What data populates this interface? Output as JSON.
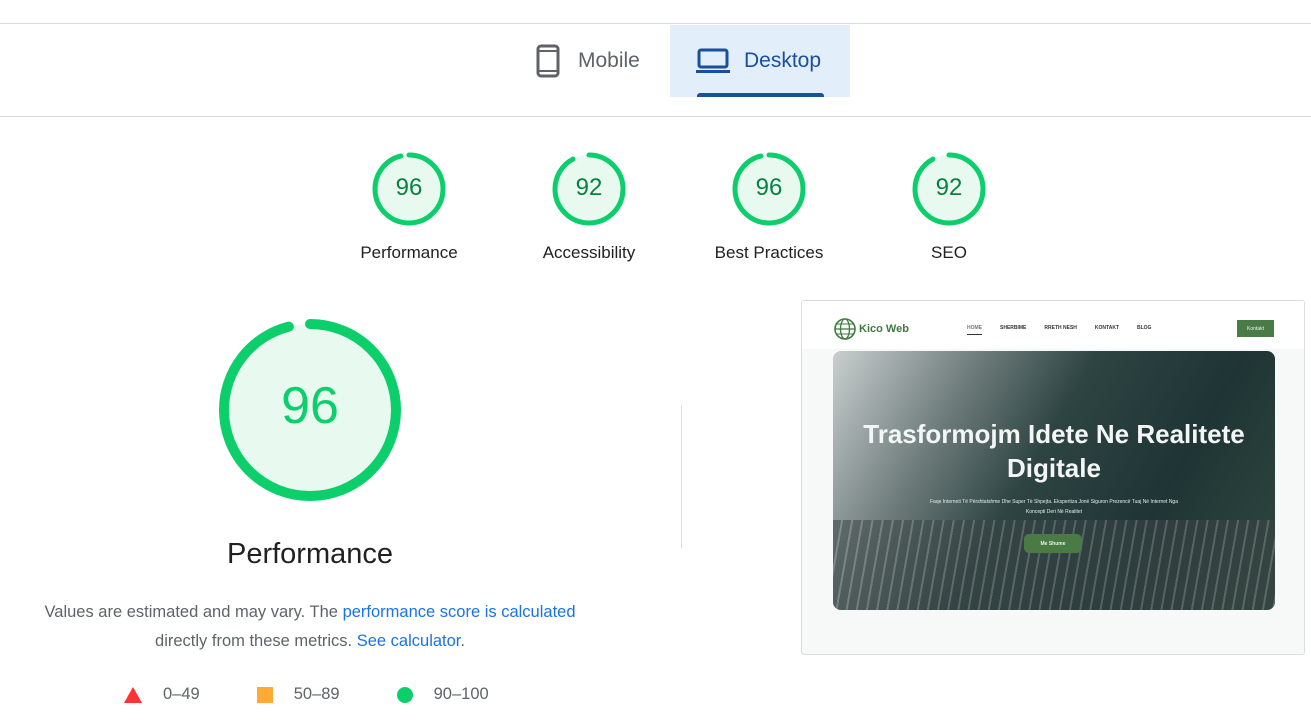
{
  "tabs": [
    {
      "label": "Mobile",
      "icon": "mobile-phone-icon",
      "selected": false
    },
    {
      "label": "Desktop",
      "icon": "laptop-icon",
      "selected": true
    }
  ],
  "categories": [
    {
      "label": "Performance",
      "score": 96
    },
    {
      "label": "Accessibility",
      "score": 92
    },
    {
      "label": "Best Practices",
      "score": 96
    },
    {
      "label": "SEO",
      "score": 92
    }
  ],
  "main": {
    "score": 96,
    "title": "Performance",
    "desc_prefix": "Values are estimated and may vary. The ",
    "desc_link": "performance score is calculated",
    "desc_mid": " directly from these metrics. ",
    "desc_link2": "See calculator",
    "desc_suffix": "."
  },
  "legend": [
    {
      "label": "0–49",
      "color": "#ff3333",
      "shape": "triangle"
    },
    {
      "label": "50–89",
      "color": "#ffaa33",
      "shape": "square"
    },
    {
      "label": "90–100",
      "color": "#0cce6b",
      "shape": "circle"
    }
  ],
  "colors": {
    "pass": "#0cce6b",
    "pass_fill": "#e8f9ef",
    "pass_text": "#0b8043",
    "accent": "#1a4fa0"
  },
  "screenshot": {
    "logo": "Kico Web",
    "nav": [
      "HOME",
      "SHERBIME",
      "RRETH NESH",
      "KONTAKT",
      "BLOG"
    ],
    "cta": "Kontakt",
    "headline": "Trasformojm Idete Ne Realitete Digitale",
    "subtext": "Faqe Interneti Të Përshtatshme Dhe Super Të Shpejta. Ekspertiza Jonë Siguron Prezencë Tuaj Në Internet Nga Koncepti Deri Në Realitet",
    "button": "Me Shume"
  }
}
